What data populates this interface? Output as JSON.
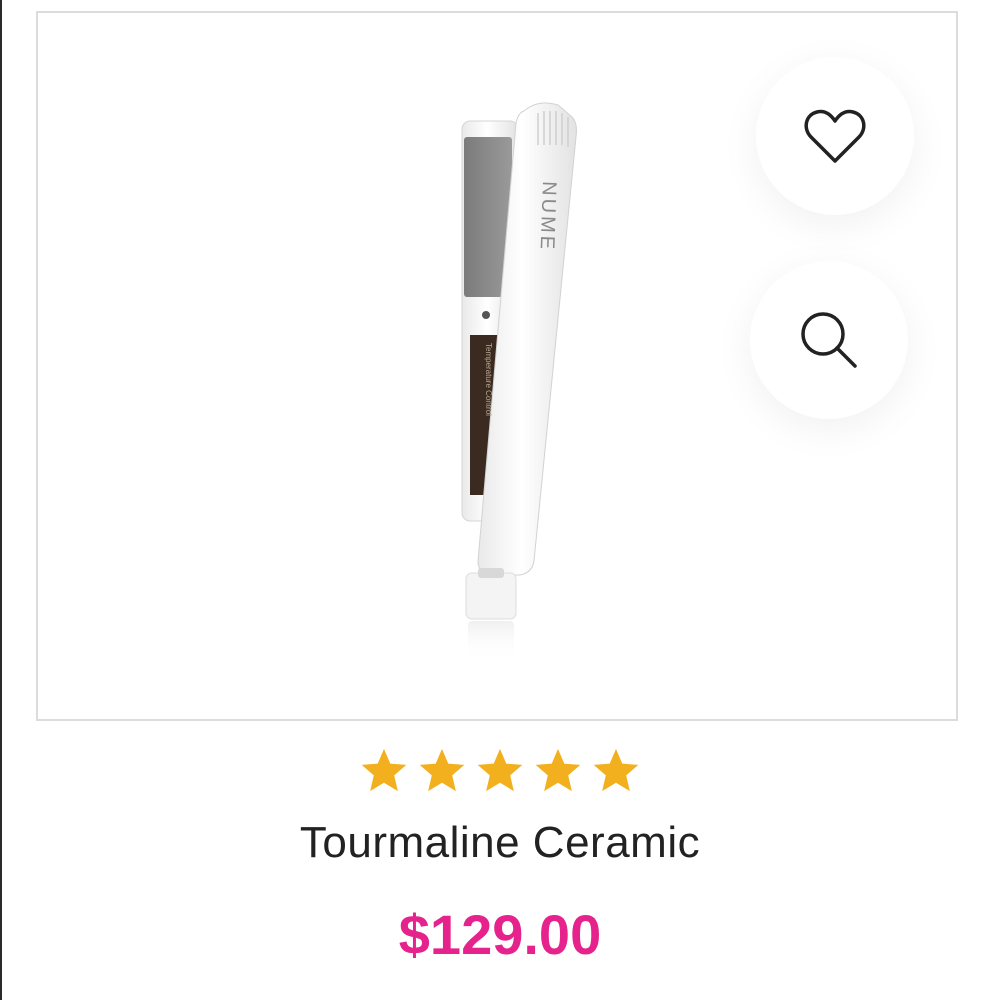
{
  "product": {
    "brand_mark": "NUME",
    "control_label": "Temperature Control",
    "name": "Tourmaline Ceramic",
    "price": "$129.00",
    "rating": 5,
    "rating_max": 5
  },
  "actions": {
    "wishlist_icon": "heart-outline-icon",
    "quickview_icon": "magnifier-icon"
  },
  "colors": {
    "price": "#e6238c",
    "star": "#f2b01e",
    "border": "#dcdcdc"
  }
}
